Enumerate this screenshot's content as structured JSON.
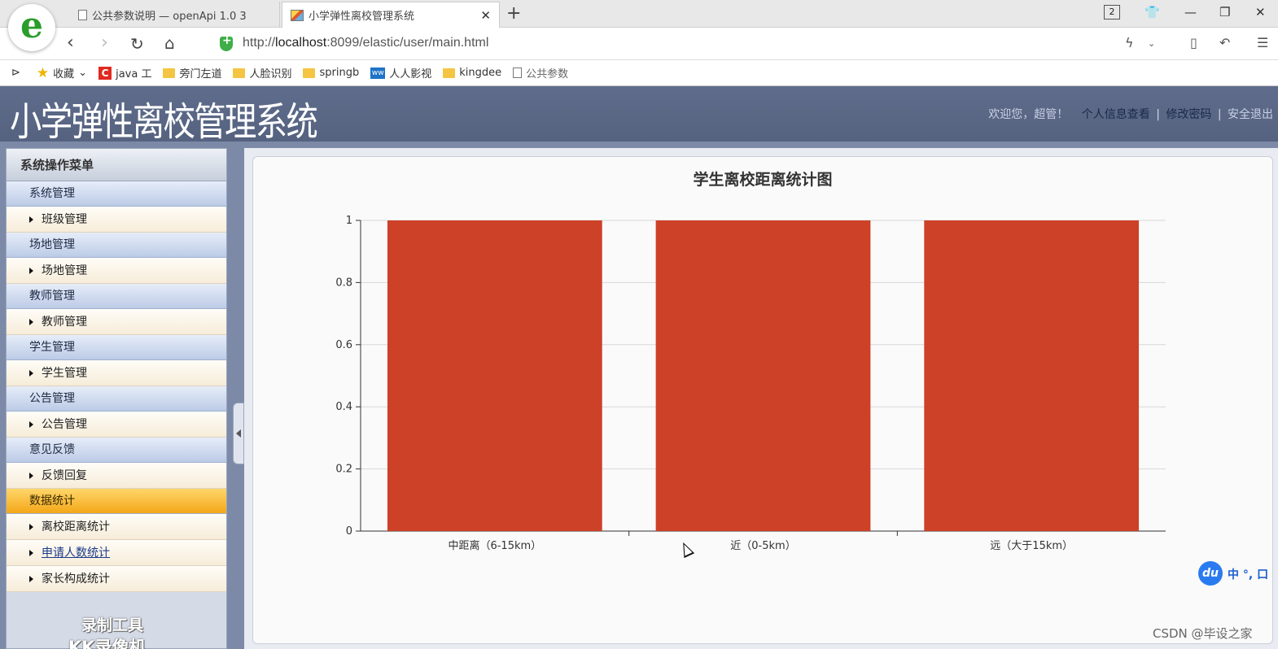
{
  "browser": {
    "tabs": [
      {
        "title": "公共参数说明 — openApi 1.0 3"
      },
      {
        "title": "小学弹性离校管理系统"
      }
    ],
    "tab_count": "2",
    "url_prefix": "http://",
    "url_host": "localhost",
    "url_rest": ":8099/elastic/user/main.html",
    "bookmarks": [
      {
        "label": "收藏",
        "icon": "star-icon"
      },
      {
        "label": "java 工",
        "icon": "csdn-icon"
      },
      {
        "label": "旁门左道",
        "icon": "folder-icon"
      },
      {
        "label": "人脸识别",
        "icon": "folder-icon"
      },
      {
        "label": "springb",
        "icon": "folder-icon"
      },
      {
        "label": "人人影视",
        "icon": "video-icon"
      },
      {
        "label": "kingdee",
        "icon": "folder-icon"
      },
      {
        "label": "公共参数",
        "icon": "doc-icon"
      }
    ]
  },
  "header": {
    "title": "小学弹性离校管理系统",
    "welcome": "欢迎您，超管！",
    "profile_link": "个人信息查看",
    "password_link": "修改密码",
    "logout_link": "安全退出",
    "separator": "|"
  },
  "sidebar": {
    "title": "系统操作菜单",
    "groups": [
      {
        "label": "系统管理",
        "items": [
          "班级管理"
        ]
      },
      {
        "label": "场地管理",
        "items": [
          "场地管理"
        ]
      },
      {
        "label": "教师管理",
        "items": [
          "教师管理"
        ]
      },
      {
        "label": "学生管理",
        "items": [
          "学生管理"
        ]
      },
      {
        "label": "公告管理",
        "items": [
          "公告管理"
        ]
      },
      {
        "label": "意见反馈",
        "items": [
          "反馈回复"
        ]
      },
      {
        "label": "数据统计",
        "items": [
          "离校距离统计",
          "申请人数统计",
          "家长构成统计"
        ],
        "active": true
      }
    ],
    "watermark_line1": "录制工具",
    "watermark_line2": "KK录像机"
  },
  "chart_data": {
    "type": "bar",
    "title": "学生离校距离统计图",
    "categories": [
      "中距离（6-15km）",
      "近（0-5km）",
      "远（大于15km）"
    ],
    "values": [
      1,
      1,
      1
    ],
    "ylim": [
      0,
      1
    ],
    "yticks": [
      0,
      0.2,
      0.4,
      0.6,
      0.8,
      1
    ],
    "ytick_labels": [
      "0",
      "0.2",
      "0.4",
      "0.6",
      "0.8",
      "1"
    ],
    "grid": true,
    "bar_color": "#cc4128"
  },
  "overlay": {
    "ime_text": "中 °, 口",
    "csdn": "CSDN @毕设之家"
  },
  "colors": {
    "header_bg": "#5a6785",
    "active_group": "#f4a718"
  }
}
